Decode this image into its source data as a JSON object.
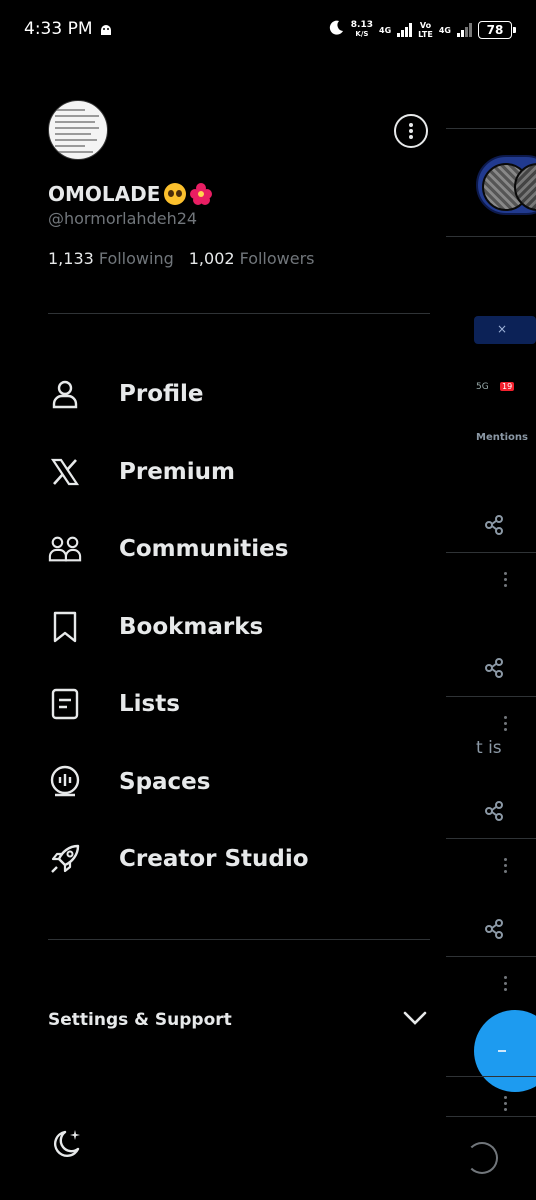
{
  "status_bar": {
    "time": "4:33 PM",
    "speed_value": "8.13",
    "speed_unit": "K/S",
    "net1": "4G",
    "volte_top": "Vo",
    "volte_bottom": "LTE",
    "net2": "4G",
    "battery": "78",
    "icons": [
      "android-icon",
      "moon-icon",
      "signal-icon",
      "battery-icon"
    ]
  },
  "profile": {
    "display_name": "OMOLADE",
    "name_emojis": [
      "pleading-face-emoji",
      "hibiscus-emoji"
    ],
    "handle": "@hormorlahdeh24",
    "following_count": "1,133",
    "following_label": "Following",
    "followers_count": "1,002",
    "followers_label": "Followers"
  },
  "menu": {
    "items": [
      {
        "label": "Profile",
        "icon": "person-icon"
      },
      {
        "label": "Premium",
        "icon": "x-logo-icon"
      },
      {
        "label": "Communities",
        "icon": "communities-icon"
      },
      {
        "label": "Bookmarks",
        "icon": "bookmark-icon"
      },
      {
        "label": "Lists",
        "icon": "list-icon"
      },
      {
        "label": "Spaces",
        "icon": "spaces-icon"
      },
      {
        "label": "Creator Studio",
        "icon": "rocket-icon"
      }
    ]
  },
  "settings": {
    "label": "Settings & Support",
    "expanded": false
  },
  "background": {
    "mentions_text": "Mentions",
    "partial_text": "t is"
  },
  "colors": {
    "background": "#000000",
    "primary_text": "#e7e9ea",
    "secondary_text": "#71767b",
    "divider": "#2f3336",
    "accent": "#1d9bf0"
  }
}
